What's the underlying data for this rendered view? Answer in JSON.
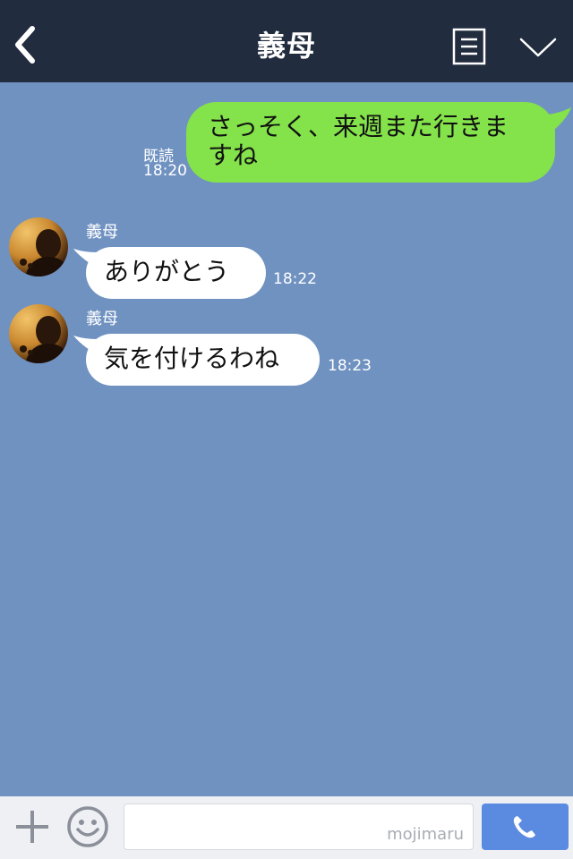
{
  "header": {
    "title": "義母",
    "back_icon": "chevron-left-icon",
    "menu_icon": "document-list-icon",
    "collapse_icon": "chevron-down-icon",
    "background_color": "#222c3f"
  },
  "chat": {
    "background_color": "#7092c1",
    "messages": [
      {
        "direction": "outgoing",
        "text_line1": "さっそく、来週また行きま",
        "text_line2": "すね",
        "read_label": "既読",
        "time": "18:20",
        "bubble_color": "#84e24a"
      },
      {
        "direction": "incoming",
        "sender": "義母",
        "text": "ありがとう",
        "time": "18:22",
        "bubble_color": "#ffffff"
      },
      {
        "direction": "incoming",
        "sender": "義母",
        "text": "気を付けるわね",
        "time": "18:23",
        "bubble_color": "#ffffff"
      }
    ]
  },
  "input_bar": {
    "plus_icon": "plus-icon",
    "emoji_icon": "smiley-icon",
    "input_value": "",
    "watermark": "mojimaru",
    "call_icon": "phone-icon",
    "call_button_color": "#5a8be0"
  }
}
